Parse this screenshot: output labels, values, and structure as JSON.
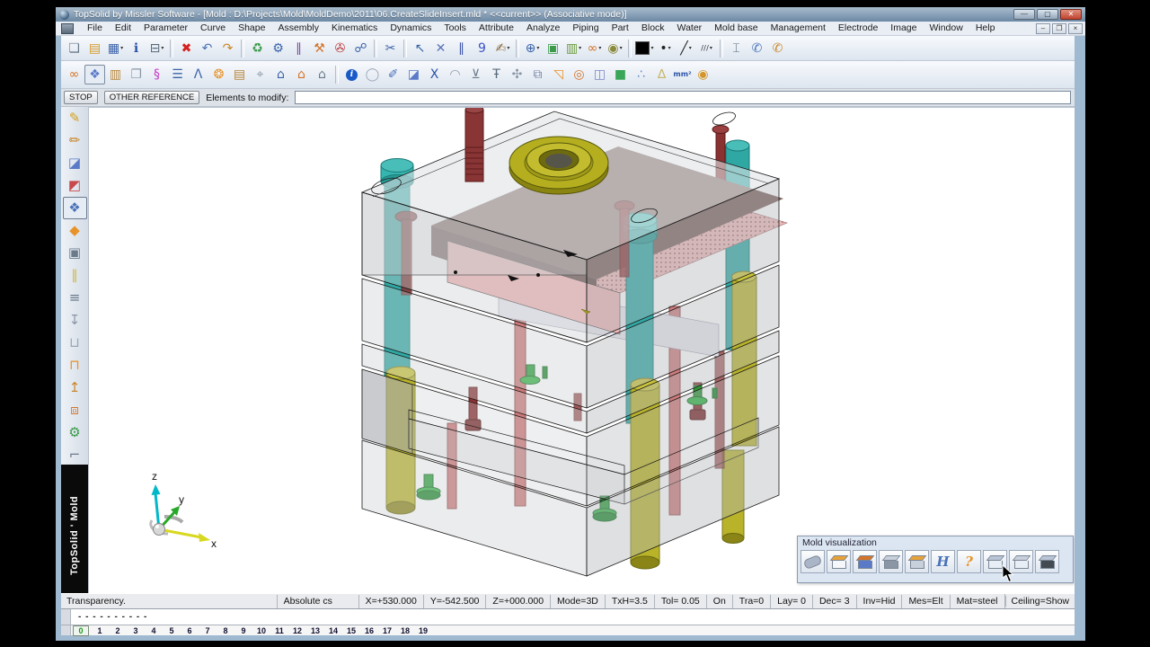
{
  "window": {
    "title": "TopSolid by Missler Software - [Mold : D:\\Projects\\Mold\\MoldDemo\\2011\\06.CreateSlideInsert.mld * <<current>> (Associative mode)]",
    "controls": {
      "minimize": "—",
      "maximize": "▢",
      "close": "✕"
    },
    "mdi_controls": {
      "minimize": "–",
      "restore": "❐",
      "close": "×"
    }
  },
  "menus": [
    "File",
    "Edit",
    "Parameter",
    "Curve",
    "Shape",
    "Assembly",
    "Kinematics",
    "Dynamics",
    "Tools",
    "Attribute",
    "Analyze",
    "Piping",
    "Part",
    "Block",
    "Water",
    "Mold base",
    "Management",
    "Electrode",
    "Image",
    "Window",
    "Help"
  ],
  "toolbar1": [
    {
      "n": "new-document",
      "g": "❏",
      "c": "#6a7a8a"
    },
    {
      "n": "open-folder",
      "g": "▤",
      "c": "#d49a2a"
    },
    {
      "n": "save",
      "g": "▦",
      "c": "#3a62a8",
      "dd": 1
    },
    {
      "n": "document-info",
      "g": "ℹ",
      "c": "#2a52a8"
    },
    {
      "n": "print",
      "g": "⊟",
      "c": "#5a6a7a",
      "dd": 1
    },
    {
      "sep": 1
    },
    {
      "n": "delete",
      "g": "✖",
      "c": "#d42020"
    },
    {
      "n": "undo",
      "g": "↶",
      "c": "#4a72b8"
    },
    {
      "n": "redo",
      "g": "↷",
      "c": "#c8862a"
    },
    {
      "sep": 1
    },
    {
      "n": "regenerate",
      "g": "♻",
      "c": "#3a9a4a"
    },
    {
      "n": "edit-tool",
      "g": "⚙",
      "c": "#3a62a8"
    },
    {
      "n": "parameter-sliders",
      "g": "∥",
      "c": "#7a4a9a"
    },
    {
      "n": "build-hammer",
      "g": "⚒",
      "c": "#d4742a"
    },
    {
      "n": "anchor-tool",
      "g": "✇",
      "c": "#b83a3a"
    },
    {
      "n": "link-tool",
      "g": "☍",
      "c": "#3a62a8"
    },
    {
      "sep": 1
    },
    {
      "n": "edit-selection",
      "g": "✂",
      "c": "#3a62a8"
    },
    {
      "sep": 1
    },
    {
      "n": "select-arrow",
      "g": "↖",
      "c": "#3a62a8"
    },
    {
      "n": "select-cross",
      "g": "✕",
      "c": "#5a72b8"
    },
    {
      "n": "pin-pair",
      "g": "∥",
      "c": "#3a52a8"
    },
    {
      "n": "measure-nine",
      "g": "9",
      "c": "#3a52c8"
    },
    {
      "n": "hand-pen",
      "g": "✍",
      "c": "#8a6a3a",
      "dd": 1
    },
    {
      "sep": 1
    },
    {
      "n": "zoom",
      "g": "⊕",
      "c": "#3a62a8",
      "dd": 1
    },
    {
      "n": "fit-frame",
      "g": "▣",
      "c": "#3a9a4a"
    },
    {
      "n": "image-view",
      "g": "▥",
      "c": "#6a9a3a",
      "dd": 1
    },
    {
      "n": "shading-goggles",
      "g": "∞",
      "c": "#d4742a",
      "dd": 1
    },
    {
      "n": "render-mode",
      "g": "◉",
      "c": "#8a8a3a",
      "dd": 1
    },
    {
      "sep": 1
    },
    {
      "n": "color-swatch",
      "swatch": "#000000",
      "dd": 1
    },
    {
      "n": "point-style",
      "g": "•",
      "c": "#222222",
      "dd": 1
    },
    {
      "n": "line-style",
      "g": "╱",
      "c": "#222222",
      "dd": 1
    },
    {
      "n": "hatch-style",
      "g": "///",
      "c": "#556",
      "txt": 1,
      "dd": 1
    },
    {
      "sep": 1
    },
    {
      "n": "vise-tool",
      "g": "⌶",
      "c": "#5a6a7a"
    },
    {
      "n": "grab-view-blue",
      "g": "✆",
      "c": "#4a72b8"
    },
    {
      "n": "grab-view-orange",
      "g": "✆",
      "c": "#c8862a"
    }
  ],
  "toolbar2": [
    {
      "n": "shading-goggles-2",
      "g": "∞",
      "c": "#d4742a"
    },
    {
      "n": "shape-display",
      "g": "❖",
      "c": "#5a7ac8",
      "pressed": 1
    },
    {
      "n": "component-crate",
      "g": "▥",
      "c": "#b8863a"
    },
    {
      "n": "document-copy",
      "g": "❐",
      "c": "#8a96a6"
    },
    {
      "n": "palette-curve",
      "g": "§",
      "c": "#c23ac2"
    },
    {
      "n": "parameter-list",
      "g": "☰",
      "c": "#3a62a8"
    },
    {
      "n": "text-lambda",
      "g": "Λ",
      "c": "#3a62a8"
    },
    {
      "n": "fruit-balls",
      "g": "❂",
      "c": "#e8932a"
    },
    {
      "n": "basket",
      "g": "▤",
      "c": "#b8863a"
    },
    {
      "n": "mouse-tool",
      "g": "⌖",
      "c": "#8a96a6"
    },
    {
      "n": "home-family-blue",
      "g": "⌂",
      "c": "#3a62a8"
    },
    {
      "n": "home-family-orange",
      "g": "⌂",
      "c": "#d4742a"
    },
    {
      "n": "home-family-grey",
      "g": "⌂",
      "c": "#6a7a8a"
    },
    {
      "sep": 1
    },
    {
      "n": "info-circle",
      "g": "i",
      "circle": "#1a5ac8",
      "c": "#ffffff"
    },
    {
      "n": "circle-tool",
      "g": "◯",
      "c": "#9aa6b6"
    },
    {
      "n": "pen-tool",
      "g": "✐",
      "c": "#4a72b8"
    },
    {
      "n": "solid-cube",
      "g": "◪",
      "c": "#5a7ac8"
    },
    {
      "n": "param-x-list",
      "g": "X",
      "c": "#2a52a8"
    },
    {
      "n": "dome-tool",
      "g": "◠",
      "c": "#8a96a6"
    },
    {
      "n": "drill-tool",
      "g": "⊻",
      "c": "#6a7a8a"
    },
    {
      "n": "depth-gauge",
      "g": "Ŧ",
      "c": "#5a6a7a"
    },
    {
      "n": "fan-tool",
      "g": "✣",
      "c": "#8a96a6"
    },
    {
      "n": "corner-shapes",
      "g": "⧉",
      "c": "#7a86a6"
    },
    {
      "n": "elbow-duct",
      "g": "◹",
      "c": "#e8932a"
    },
    {
      "n": "torus-arrow",
      "g": "◎",
      "c": "#d4742a"
    },
    {
      "n": "block-box",
      "g": "◫",
      "c": "#7a86c6"
    },
    {
      "n": "green-cube",
      "g": "■",
      "c": "#3aa65a"
    },
    {
      "n": "point-cloud",
      "g": "∴",
      "c": "#6a86c6"
    },
    {
      "n": "bottle-tool",
      "g": "∆",
      "c": "#c8b86a"
    },
    {
      "n": "area-mm2",
      "g": "mm²",
      "c": "#2a52a8",
      "txt": 1
    },
    {
      "n": "cylinder-gold",
      "g": "◉",
      "c": "#d4962a"
    }
  ],
  "left_toolbar": [
    {
      "n": "sketch-pencil",
      "g": "✎",
      "c": "#d4a017"
    },
    {
      "n": "curve-pen",
      "g": "✏",
      "c": "#c8862a"
    },
    {
      "n": "solid-box",
      "g": "◪",
      "c": "#5a7ac8"
    },
    {
      "n": "mold-shape",
      "g": "◩",
      "c": "#c84a4a"
    },
    {
      "n": "mold-palette",
      "g": "❖",
      "c": "#4a72b8",
      "pressed": 1
    },
    {
      "n": "insert-shape",
      "g": "◆",
      "c": "#e8932a"
    },
    {
      "n": "block-tool",
      "g": "▣",
      "c": "#6a7a8a"
    },
    {
      "n": "ejector-pins",
      "g": "∥",
      "c": "#c8b84a"
    },
    {
      "n": "plate-stack",
      "g": "≡",
      "c": "#6a7a8a"
    },
    {
      "n": "screw-tool",
      "g": "↧",
      "c": "#8a96a6"
    },
    {
      "n": "bushing-tool",
      "g": "⊔",
      "c": "#9aa6b6"
    },
    {
      "n": "mold-insert",
      "g": "⊓",
      "c": "#e8932a"
    },
    {
      "n": "pin-screw",
      "g": "↥",
      "c": "#c8862a"
    },
    {
      "n": "box-3d",
      "g": "⧈",
      "c": "#d4742a"
    },
    {
      "n": "gear-balls",
      "g": "⚙",
      "c": "#3a9a4a"
    },
    {
      "n": "chute-tool",
      "g": "⌐",
      "c": "#6a7a8a"
    }
  ],
  "command_bar": {
    "stop_label": "STOP",
    "other_reference_label": "OTHER REFERENCE",
    "field_label": "Elements to modify:",
    "field_value": ""
  },
  "branding": {
    "vertical_text": "TopSolid ' Mold"
  },
  "viewport": {
    "axis_labels": {
      "x": "x",
      "y": "y",
      "z": "z"
    }
  },
  "mold_panel": {
    "title": "Mold visualization",
    "buttons": [
      {
        "n": "show-part",
        "shape": "blob",
        "c1": "#aab6c8"
      },
      {
        "n": "show-cavity-core",
        "shape": "box",
        "c1": "#e8a23a",
        "c2": "#f5f7fa"
      },
      {
        "n": "show-slide-unit",
        "shape": "box",
        "c1": "#d4742a",
        "c2": "#5a7ac8"
      },
      {
        "n": "show-mold-plates",
        "shape": "box",
        "c1": "#c8d0dc",
        "c2": "#8a96a6"
      },
      {
        "n": "show-ejector",
        "shape": "box",
        "c1": "#e8a23a",
        "c2": "#c8d0dc"
      },
      {
        "n": "show-runners",
        "g": "H",
        "c": "#4a72b8"
      },
      {
        "n": "show-question",
        "g": "?",
        "c": "#e8932a"
      },
      {
        "n": "show-table",
        "shape": "box",
        "c1": "#b9c4d6",
        "c2": "#e8eef5"
      },
      {
        "n": "show-mold-base",
        "shape": "box",
        "c1": "#c8d0dc",
        "c2": "#e8eef5"
      },
      {
        "n": "show-preview",
        "shape": "box",
        "c1": "#b9c4d6",
        "c2": "#444a52"
      }
    ]
  },
  "status_bar": {
    "left": "Transparency.",
    "cs": "Absolute cs",
    "fields": [
      "X=+530.000",
      "Y=-542.500",
      "Z=+000.000",
      "Mode=3D",
      "TxH=3.5",
      "Tol= 0.05",
      "On",
      "Tra=0",
      "Lay= 0",
      "Dec= 3",
      "Inv=Hid",
      "Mes=Elt",
      "Mat=steel"
    ],
    "right": "Ceiling=Show"
  },
  "alt_bar": {
    "dashes": "- - - - - - - - - -"
  },
  "tabs": {
    "items": [
      "0",
      "1",
      "2",
      "3",
      "4",
      "5",
      "6",
      "7",
      "8",
      "9",
      "10",
      "11",
      "12",
      "13",
      "14",
      "15",
      "16",
      "17",
      "18",
      "19"
    ],
    "active": "0"
  },
  "colors": {
    "plate_glass": "#c8cace",
    "guide_pillar_teal": "#2fa8a4",
    "support_pillar_yellow": "#b9b32a",
    "screw_maroon": "#8a3232",
    "cavity_pink": "#edb5b5",
    "cavity_dark": "#7d615d",
    "locating_ring": "#b5af20",
    "stop_button_green": "#2aa03a",
    "axis_x": "#d8d820",
    "axis_y": "#28a828",
    "axis_z": "#00b8c8"
  }
}
